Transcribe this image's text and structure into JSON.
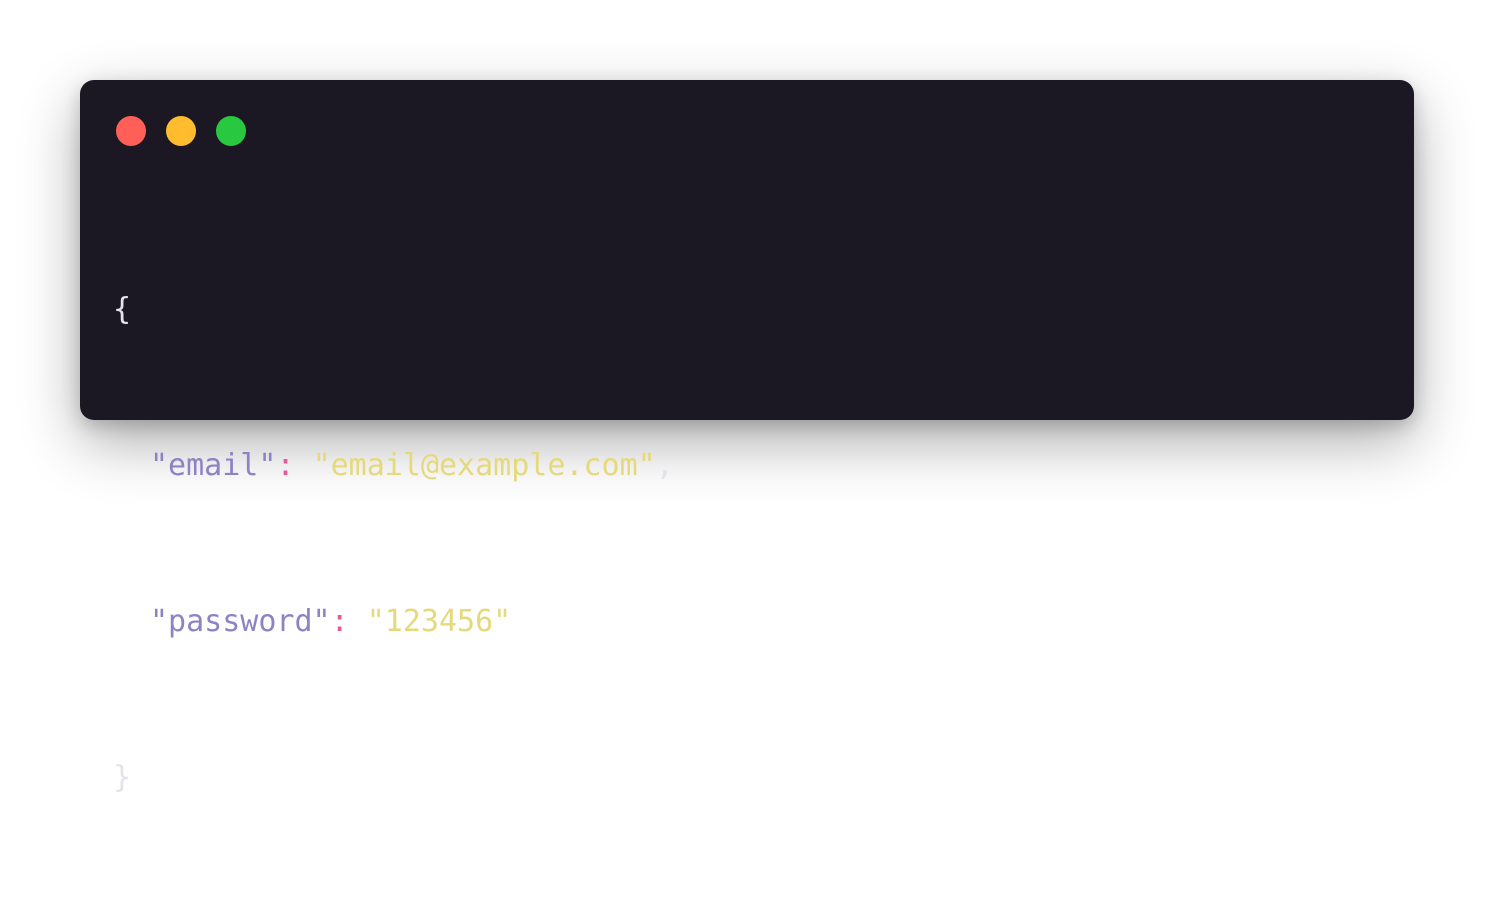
{
  "window": {
    "controls": [
      {
        "name": "close",
        "color": "#ff5f57"
      },
      {
        "name": "minimize",
        "color": "#febc2e"
      },
      {
        "name": "maximize",
        "color": "#28c840"
      }
    ]
  },
  "code": {
    "open_brace": "{",
    "close_brace": "}",
    "lines": [
      {
        "key": "\"email\"",
        "colon": ":",
        "value": "\"email@example.com\"",
        "trailing": ","
      },
      {
        "key": "\"password\"",
        "colon": ":",
        "value": "\"123456\"",
        "trailing": ""
      }
    ]
  },
  "colors": {
    "background": "#1b1823",
    "key": "#8f82c4",
    "colon": "#e5589a",
    "string": "#e5d97b",
    "punctuation": "#e6e2ea"
  }
}
